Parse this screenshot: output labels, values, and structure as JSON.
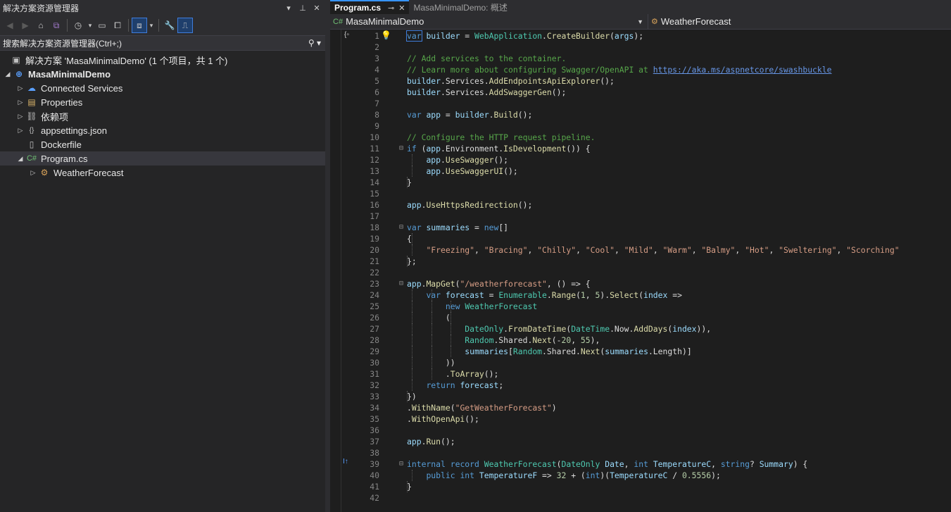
{
  "solution_explorer": {
    "title": "解决方案资源管理器",
    "title_buttons": [
      "▾",
      "⊥",
      "✕"
    ],
    "search_placeholder": "搜索解决方案资源管理器(Ctrl+;)",
    "tree": [
      {
        "label": "解决方案 'MasaMinimalDemo' (1 个项目，共 1 个)",
        "icon": "solution-icon"
      },
      {
        "label": "MasaMinimalDemo",
        "icon": "project-icon"
      },
      {
        "label": "Connected Services",
        "icon": "connected-services-icon"
      },
      {
        "label": "Properties",
        "icon": "properties-icon"
      },
      {
        "label": "依赖项",
        "icon": "dependencies-icon"
      },
      {
        "label": "appsettings.json",
        "icon": "json-file-icon"
      },
      {
        "label": "Dockerfile",
        "icon": "file-icon"
      },
      {
        "label": "Program.cs",
        "icon": "csharp-file-icon"
      },
      {
        "label": "WeatherForecast",
        "icon": "record-icon"
      }
    ]
  },
  "editor": {
    "tabs": [
      {
        "label": "Program.cs",
        "active": true
      },
      {
        "label": "MasaMinimalDemo: 概述",
        "active": false
      }
    ],
    "nav_project": "MasaMinimalDemo",
    "nav_type": "WeatherForecast",
    "line_numbers": [
      "1",
      "2",
      "3",
      "4",
      "5",
      "6",
      "7",
      "8",
      "9",
      "10",
      "11",
      "12",
      "13",
      "14",
      "15",
      "16",
      "17",
      "18",
      "19",
      "20",
      "21",
      "22",
      "23",
      "24",
      "25",
      "26",
      "27",
      "28",
      "29",
      "30",
      "31",
      "32",
      "33",
      "34",
      "35",
      "36",
      "37",
      "38",
      "39",
      "40",
      "41",
      "42"
    ],
    "code_lines": [
      "var builder = WebApplication.CreateBuilder(args);",
      "",
      "// Add services to the container.",
      "// Learn more about configuring Swagger/OpenAPI at https://aka.ms/aspnetcore/swashbuckle",
      "builder.Services.AddEndpointsApiExplorer();",
      "builder.Services.AddSwaggerGen();",
      "",
      "var app = builder.Build();",
      "",
      "// Configure the HTTP request pipeline.",
      "if (app.Environment.IsDevelopment()) {",
      "    app.UseSwagger();",
      "    app.UseSwaggerUI();",
      "}",
      "",
      "app.UseHttpsRedirection();",
      "",
      "var summaries = new[]",
      "{",
      "    \"Freezing\", \"Bracing\", \"Chilly\", \"Cool\", \"Mild\", \"Warm\", \"Balmy\", \"Hot\", \"Sweltering\", \"Scorching\"",
      "};",
      "",
      "app.MapGet(\"/weatherforecast\", () => {",
      "    var forecast = Enumerable.Range(1, 5).Select(index =>",
      "        new WeatherForecast",
      "        (",
      "            DateOnly.FromDateTime(DateTime.Now.AddDays(index)),",
      "            Random.Shared.Next(-20, 55),",
      "            summaries[Random.Shared.Next(summaries.Length)]",
      "        ))",
      "        .ToArray();",
      "    return forecast;",
      "})",
      ".WithName(\"GetWeatherForecast\")",
      ".WithOpenApi();",
      "",
      "app.Run();",
      "",
      "internal record WeatherForecast(DateOnly Date, int TemperatureC, string? Summary) {",
      "    public int TemperatureF => 32 + (int)(TemperatureC / 0.5556);",
      "}",
      ""
    ]
  }
}
